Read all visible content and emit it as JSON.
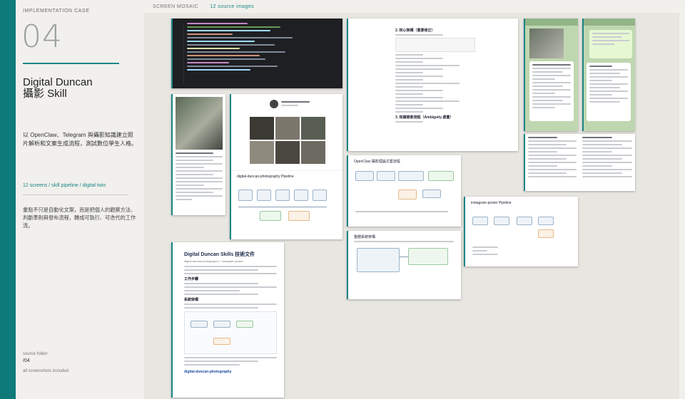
{
  "left": {
    "eyebrow": "IMPLEMENTATION CASE",
    "number": "04",
    "title_line1": "Digital Duncan",
    "title_line2": "攝影 Skill",
    "description": "以 OpenClaw、Telegram 與攝影知識建立照片解析和文案生成流程，測試數位學生人格。",
    "tags": "12 screens / skill pipeline / digital twin",
    "note": "重點不只是自動化文案，而是把個人的觀察方法、判斷準則與發布流程，轉成可執行、可迭代的工作流。",
    "source_label": "source folder",
    "source_value": "/04",
    "source_foot": "all screenshots included"
  },
  "mosaic": {
    "label": "SCREEN MOSAIC",
    "count": "12 source images"
  },
  "shots": {
    "pipeline_title": "digital-duncan-photography Pipeline",
    "openclaw_title": "OpenClaw 攝影理論文案流程",
    "insta_title": "instagram-poster Pipeline",
    "arch_title": "整體系統架構",
    "doc_title": "Digital Duncan Skills 技術文件",
    "doc_subtitle": "digital-duncan-photography + instagram-poster",
    "doc_sec1": "工作步驟",
    "doc_sec2": "系統架構",
    "doc_link": "digital-duncan-photography",
    "notes_sec1": "2. 核心架構（重要修正）",
    "notes_sec2": "3. 知識檢索流程（Ambiguity 處置）"
  }
}
